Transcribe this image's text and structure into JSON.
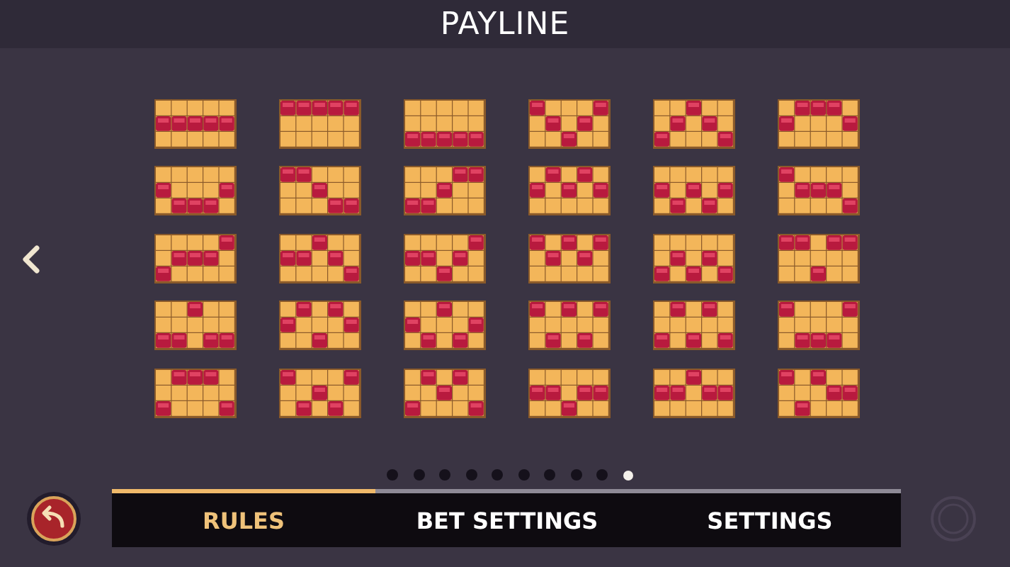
{
  "title": "PAYLINE",
  "paylines": [
    {
      "rows": [
        [
          false,
          false,
          false,
          false,
          false
        ],
        [
          true,
          true,
          true,
          true,
          true
        ],
        [
          false,
          false,
          false,
          false,
          false
        ]
      ]
    },
    {
      "rows": [
        [
          true,
          true,
          true,
          true,
          true
        ],
        [
          false,
          false,
          false,
          false,
          false
        ],
        [
          false,
          false,
          false,
          false,
          false
        ]
      ]
    },
    {
      "rows": [
        [
          false,
          false,
          false,
          false,
          false
        ],
        [
          false,
          false,
          false,
          false,
          false
        ],
        [
          true,
          true,
          true,
          true,
          true
        ]
      ]
    },
    {
      "rows": [
        [
          true,
          false,
          false,
          false,
          true
        ],
        [
          false,
          true,
          false,
          true,
          false
        ],
        [
          false,
          false,
          true,
          false,
          false
        ]
      ]
    },
    {
      "rows": [
        [
          false,
          false,
          true,
          false,
          false
        ],
        [
          false,
          true,
          false,
          true,
          false
        ],
        [
          true,
          false,
          false,
          false,
          true
        ]
      ]
    },
    {
      "rows": [
        [
          false,
          true,
          true,
          true,
          false
        ],
        [
          true,
          false,
          false,
          false,
          true
        ],
        [
          false,
          false,
          false,
          false,
          false
        ]
      ]
    },
    {
      "rows": [
        [
          false,
          false,
          false,
          false,
          false
        ],
        [
          true,
          false,
          false,
          false,
          true
        ],
        [
          false,
          true,
          true,
          true,
          false
        ]
      ]
    },
    {
      "rows": [
        [
          true,
          true,
          false,
          false,
          false
        ],
        [
          false,
          false,
          true,
          false,
          false
        ],
        [
          false,
          false,
          false,
          true,
          true
        ]
      ]
    },
    {
      "rows": [
        [
          false,
          false,
          false,
          true,
          true
        ],
        [
          false,
          false,
          true,
          false,
          false
        ],
        [
          true,
          true,
          false,
          false,
          false
        ]
      ]
    },
    {
      "rows": [
        [
          false,
          true,
          false,
          true,
          false
        ],
        [
          true,
          false,
          true,
          false,
          true
        ],
        [
          false,
          false,
          false,
          false,
          false
        ]
      ]
    },
    {
      "rows": [
        [
          false,
          false,
          false,
          false,
          false
        ],
        [
          true,
          false,
          true,
          false,
          true
        ],
        [
          false,
          true,
          false,
          true,
          false
        ]
      ]
    },
    {
      "rows": [
        [
          true,
          false,
          false,
          false,
          false
        ],
        [
          false,
          true,
          true,
          true,
          false
        ],
        [
          false,
          false,
          false,
          false,
          true
        ]
      ]
    },
    {
      "rows": [
        [
          false,
          false,
          false,
          false,
          true
        ],
        [
          false,
          true,
          true,
          true,
          false
        ],
        [
          true,
          false,
          false,
          false,
          false
        ]
      ]
    },
    {
      "rows": [
        [
          false,
          false,
          true,
          false,
          false
        ],
        [
          true,
          true,
          false,
          true,
          false
        ],
        [
          false,
          false,
          false,
          false,
          true
        ]
      ]
    },
    {
      "rows": [
        [
          false,
          false,
          false,
          false,
          true
        ],
        [
          true,
          true,
          false,
          true,
          false
        ],
        [
          false,
          false,
          true,
          false,
          false
        ]
      ]
    },
    {
      "rows": [
        [
          true,
          false,
          true,
          false,
          true
        ],
        [
          false,
          true,
          false,
          true,
          false
        ],
        [
          false,
          false,
          false,
          false,
          false
        ]
      ]
    },
    {
      "rows": [
        [
          false,
          false,
          false,
          false,
          false
        ],
        [
          false,
          true,
          false,
          true,
          false
        ],
        [
          true,
          false,
          true,
          false,
          true
        ]
      ]
    },
    {
      "rows": [
        [
          true,
          true,
          false,
          true,
          true
        ],
        [
          false,
          false,
          false,
          false,
          false
        ],
        [
          false,
          false,
          true,
          false,
          false
        ]
      ]
    },
    {
      "rows": [
        [
          false,
          false,
          true,
          false,
          false
        ],
        [
          false,
          false,
          false,
          false,
          false
        ],
        [
          true,
          true,
          false,
          true,
          true
        ]
      ]
    },
    {
      "rows": [
        [
          false,
          true,
          false,
          true,
          false
        ],
        [
          true,
          false,
          false,
          false,
          true
        ],
        [
          false,
          false,
          true,
          false,
          false
        ]
      ]
    },
    {
      "rows": [
        [
          false,
          false,
          true,
          false,
          false
        ],
        [
          true,
          false,
          false,
          false,
          true
        ],
        [
          false,
          true,
          false,
          true,
          false
        ]
      ]
    },
    {
      "rows": [
        [
          true,
          false,
          true,
          false,
          true
        ],
        [
          false,
          false,
          false,
          false,
          false
        ],
        [
          false,
          true,
          false,
          true,
          false
        ]
      ]
    },
    {
      "rows": [
        [
          false,
          true,
          false,
          true,
          false
        ],
        [
          false,
          false,
          false,
          false,
          false
        ],
        [
          true,
          false,
          true,
          false,
          true
        ]
      ]
    },
    {
      "rows": [
        [
          true,
          false,
          false,
          false,
          true
        ],
        [
          false,
          false,
          false,
          false,
          false
        ],
        [
          false,
          true,
          true,
          true,
          false
        ]
      ]
    },
    {
      "rows": [
        [
          false,
          true,
          true,
          true,
          false
        ],
        [
          false,
          false,
          false,
          false,
          false
        ],
        [
          true,
          false,
          false,
          false,
          true
        ]
      ]
    },
    {
      "rows": [
        [
          true,
          false,
          false,
          false,
          true
        ],
        [
          false,
          false,
          true,
          false,
          false
        ],
        [
          false,
          true,
          false,
          true,
          false
        ]
      ]
    },
    {
      "rows": [
        [
          false,
          true,
          false,
          true,
          false
        ],
        [
          false,
          false,
          true,
          false,
          false
        ],
        [
          true,
          false,
          false,
          false,
          true
        ]
      ]
    },
    {
      "rows": [
        [
          false,
          false,
          false,
          false,
          false
        ],
        [
          true,
          true,
          false,
          true,
          true
        ],
        [
          false,
          false,
          true,
          false,
          false
        ]
      ]
    },
    {
      "rows": [
        [
          false,
          false,
          true,
          false,
          false
        ],
        [
          true,
          true,
          false,
          true,
          true
        ],
        [
          false,
          false,
          false,
          false,
          false
        ]
      ]
    },
    {
      "rows": [
        [
          true,
          false,
          true,
          false,
          false
        ],
        [
          false,
          false,
          false,
          true,
          true
        ],
        [
          false,
          true,
          false,
          false,
          false
        ]
      ]
    }
  ],
  "pages": [
    {
      "selected": false
    },
    {
      "selected": false
    },
    {
      "selected": false
    },
    {
      "selected": false
    },
    {
      "selected": false
    },
    {
      "selected": false
    },
    {
      "selected": false
    },
    {
      "selected": false
    },
    {
      "selected": false
    },
    {
      "selected": true
    }
  ],
  "tabs": [
    {
      "label": "RULES",
      "selected": true
    },
    {
      "label": "BET SETTINGS",
      "selected": false
    },
    {
      "label": "SETTINGS",
      "selected": false
    }
  ]
}
